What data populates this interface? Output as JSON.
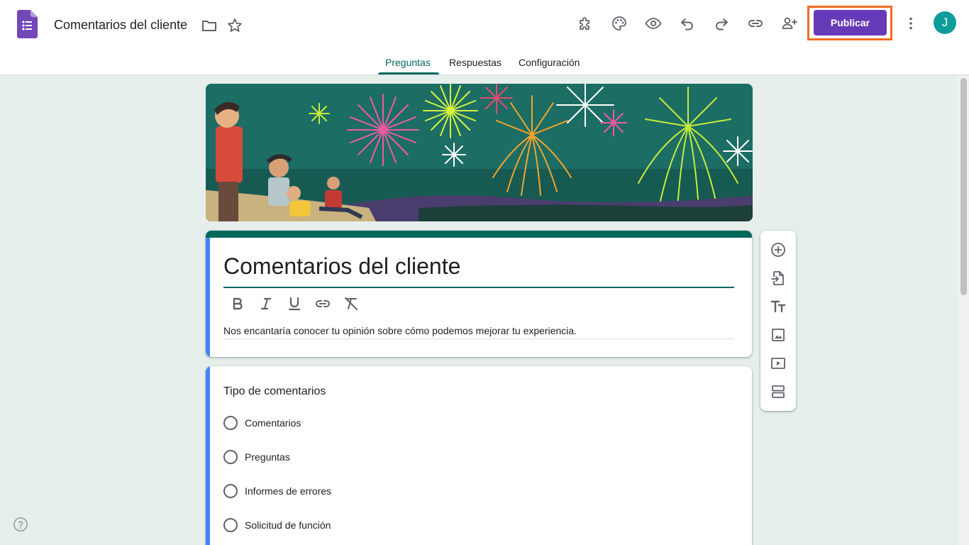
{
  "header": {
    "doc_title": "Comentarios del cliente",
    "publish_label": "Publicar",
    "avatar_initial": "J"
  },
  "tabs": [
    {
      "label": "Preguntas",
      "active": true
    },
    {
      "label": "Respuestas",
      "active": false
    },
    {
      "label": "Configuración",
      "active": false
    }
  ],
  "form": {
    "title": "Comentarios del cliente",
    "description": "Nos encantaría conocer tu opinión sobre cómo podemos mejorar tu experiencia."
  },
  "question": {
    "title": "Tipo de comentarios",
    "options": [
      "Comentarios",
      "Preguntas",
      "Informes de errores",
      "Solicitud de función"
    ]
  },
  "colors": {
    "accent": "#00695c",
    "publish": "#673ab7",
    "highlight": "#f06d1f",
    "question_bar": "#4285f4",
    "avatar": "#0f9d9c"
  },
  "icons": {
    "header": [
      "addon-icon",
      "palette-icon",
      "preview-eye-icon",
      "undo-icon",
      "redo-icon",
      "link-icon",
      "add-collaborator-icon",
      "more-vert-icon"
    ],
    "formatting": [
      "bold-icon",
      "italic-icon",
      "underline-icon",
      "link-icon",
      "clear-format-icon"
    ],
    "side_toolbar": [
      "add-question-icon",
      "import-questions-icon",
      "add-title-icon",
      "add-image-icon",
      "add-video-icon",
      "add-section-icon"
    ]
  }
}
